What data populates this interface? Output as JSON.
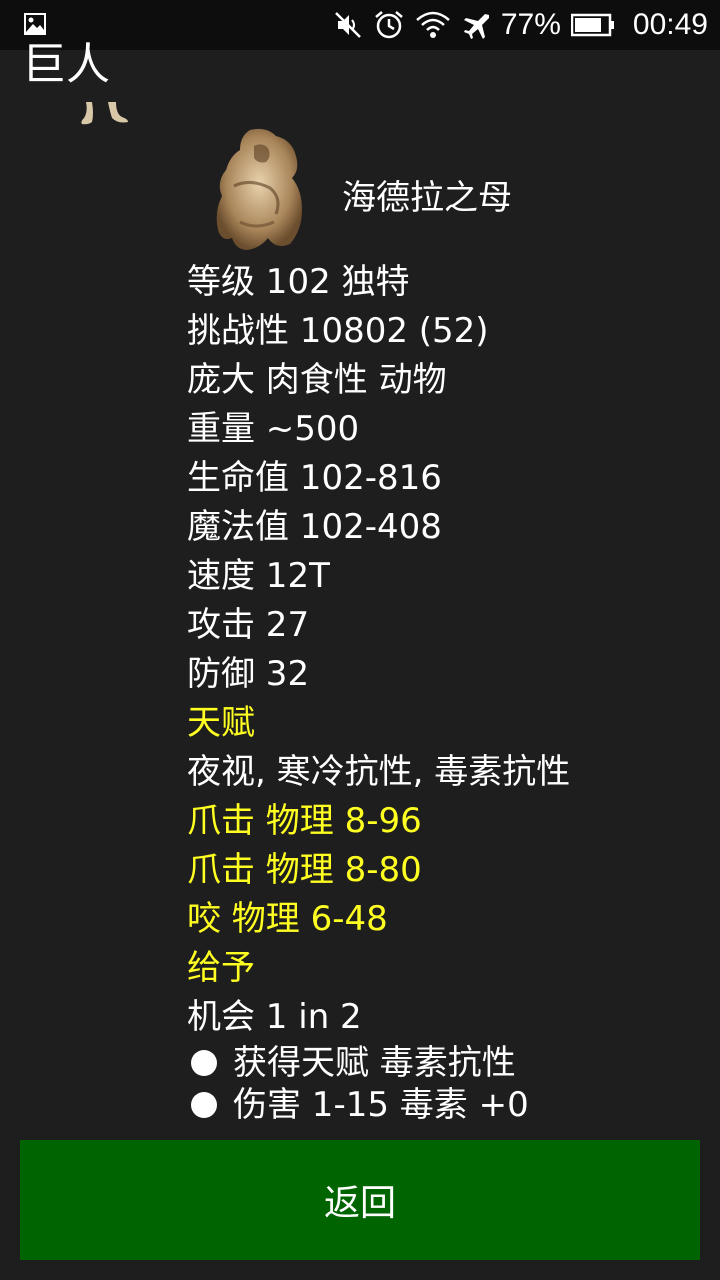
{
  "status_bar": {
    "battery": "77%",
    "time": "00:49",
    "icons": [
      "gallery-icon",
      "mute-icon",
      "alarm-icon",
      "wifi-icon",
      "airplane-icon",
      "battery-icon"
    ]
  },
  "header": {
    "title": "巨人"
  },
  "monster": {
    "name": "海德拉之母",
    "stats": [
      {
        "text": "等级 102 独特",
        "color": "white"
      },
      {
        "text": "挑战性 10802 (52)",
        "color": "white"
      },
      {
        "text": "庞大 肉食性 动物",
        "color": "white"
      },
      {
        "text": "重量 ~500",
        "color": "white"
      },
      {
        "text": "生命值 102-816",
        "color": "white"
      },
      {
        "text": "魔法值 102-408",
        "color": "white"
      },
      {
        "text": "速度 12T",
        "color": "white"
      },
      {
        "text": "攻击 27",
        "color": "white"
      },
      {
        "text": "防御 32",
        "color": "white"
      },
      {
        "text": "天赋",
        "color": "yellow"
      },
      {
        "text": "夜视, 寒冷抗性, 毒素抗性",
        "color": "white"
      },
      {
        "text": "爪击 物理 8-96",
        "color": "yellow"
      },
      {
        "text": "爪击 物理 8-80",
        "color": "yellow"
      },
      {
        "text": "咬 物理 6-48",
        "color": "yellow"
      },
      {
        "text": "给予",
        "color": "yellow"
      },
      {
        "text": "机会 1 in 2",
        "color": "white"
      }
    ],
    "effects": [
      "获得天赋 毒素抗性",
      "伤害 1-15 毒素 +0"
    ]
  },
  "back_button": {
    "label": "返回"
  },
  "colors": {
    "background": "#1e1e1e",
    "highlight": "#ffff22",
    "button": "#006400"
  }
}
